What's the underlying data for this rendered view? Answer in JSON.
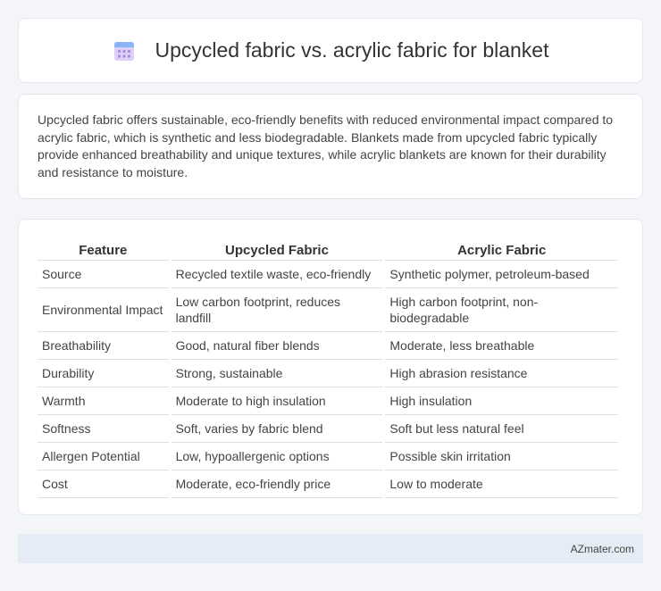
{
  "header": {
    "title": "Upcycled fabric vs. acrylic fabric for blanket",
    "icon": "calendar-icon",
    "icon_colors": {
      "top": "#8ab4f8",
      "body": "#d8c8f5",
      "dots": "#b08ee8"
    }
  },
  "description": {
    "text": "Upcycled fabric offers sustainable, eco-friendly benefits with reduced environmental impact compared to acrylic fabric, which is synthetic and less biodegradable. Blankets made from upcycled fabric typically provide enhanced breathability and unique textures, while acrylic blankets are known for their durability and resistance to moisture."
  },
  "table": {
    "headers": [
      "Feature",
      "Upcycled Fabric",
      "Acrylic Fabric"
    ],
    "rows": [
      [
        "Source",
        "Recycled textile waste, eco-friendly",
        "Synthetic polymer, petroleum-based"
      ],
      [
        "Environmental Impact",
        "Low carbon footprint, reduces landfill",
        "High carbon footprint, non-biodegradable"
      ],
      [
        "Breathability",
        "Good, natural fiber blends",
        "Moderate, less breathable"
      ],
      [
        "Durability",
        "Strong, sustainable",
        "High abrasion resistance"
      ],
      [
        "Warmth",
        "Moderate to high insulation",
        "High insulation"
      ],
      [
        "Softness",
        "Soft, varies by fabric blend",
        "Soft but less natural feel"
      ],
      [
        "Allergen Potential",
        "Low, hypoallergenic options",
        "Possible skin irritation"
      ],
      [
        "Cost",
        "Moderate, eco-friendly price",
        "Low to moderate"
      ]
    ]
  },
  "footer": {
    "text": "AZmater.com",
    "background": "#e6ecf5"
  }
}
